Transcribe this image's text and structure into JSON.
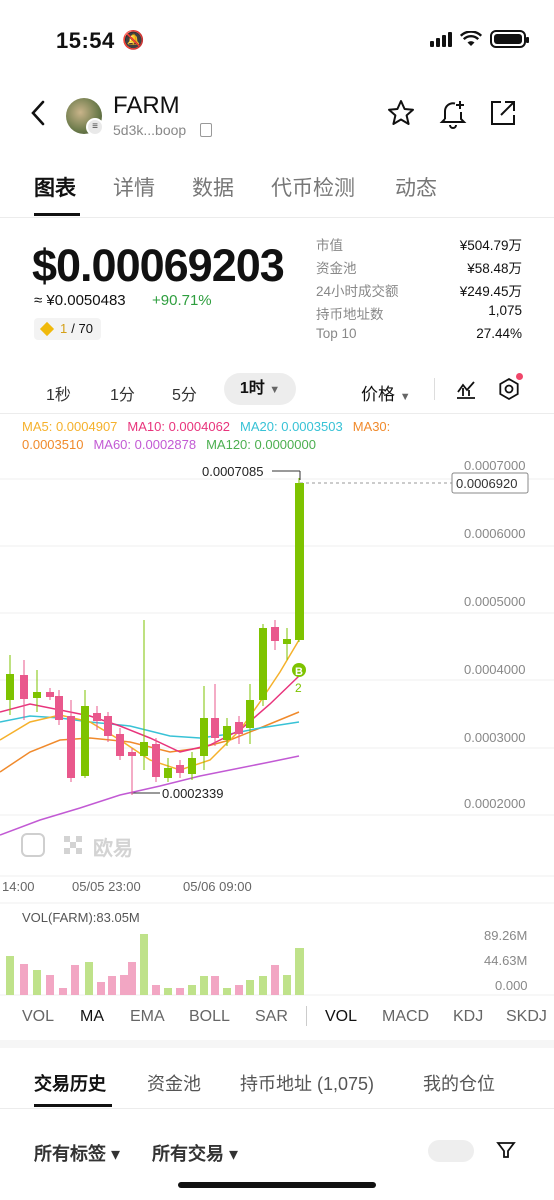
{
  "status_bar": {
    "time": "15:54"
  },
  "header": {
    "token_name": "FARM",
    "token_address": "5d3k...boop"
  },
  "tabs": [
    "图表",
    "详情",
    "数据",
    "代币检测",
    "动态"
  ],
  "price": {
    "usd": "$0.00069203",
    "cny": "≈ ¥0.0050483",
    "change": "+90.71%",
    "rank_current": "1",
    "rank_total": "/ 70"
  },
  "stats": [
    {
      "label": "市值",
      "value": "¥504.79万"
    },
    {
      "label": "资金池",
      "value": "¥58.48万"
    },
    {
      "label": "24小时成交额",
      "value": "¥249.45万"
    },
    {
      "label": "持币地址数",
      "value": "1,075"
    },
    {
      "label": "Top 10",
      "value": "27.44%"
    }
  ],
  "intervals": [
    "1秒",
    "1分",
    "5分",
    "1时"
  ],
  "active_interval": "1时",
  "price_selector": "价格",
  "ma_legend": {
    "ma5": "MA5: 0.0004907",
    "ma10": "MA10: 0.0004062",
    "ma20": "MA20: 0.0003503",
    "ma30": "MA30:",
    "ma30_val": "0.0003510",
    "ma60": "MA60: 0.0002878",
    "ma120": "MA120: 0.0000000"
  },
  "chart_data": {
    "type": "candlestick",
    "y_ticks": [
      "0.0007000",
      "0.0006000",
      "0.0005000",
      "0.0004000",
      "0.0003000",
      "0.0002000"
    ],
    "current_price_label": "0.0006920",
    "high_label": "0.0007085",
    "low_label": "0.0002339",
    "x_labels": [
      "14:00",
      "05/05 23:00",
      "05/06 09:00"
    ],
    "marker": "B",
    "marker_count": "2",
    "watermark": "欧易",
    "colors": {
      "up": "#7ec300",
      "down": "#e9588c",
      "ma5": "#f5b12c",
      "ma10": "#e8347c",
      "ma20": "#38c2d6",
      "ma30": "#f08a2c",
      "ma60": "#c25ad4",
      "ma120": "#4caf50"
    }
  },
  "volume": {
    "label": "VOL(FARM):83.05M",
    "ticks": [
      "89.26M",
      "44.63M",
      "0.000"
    ]
  },
  "indicators": [
    "VOL",
    "MA",
    "EMA",
    "BOLL",
    "SAR",
    "VOL",
    "MACD",
    "KDJ",
    "SKDJ"
  ],
  "bottom_tabs": [
    "交易历史",
    "资金池",
    "持币地址 (1,075)",
    "我的仓位"
  ],
  "filters": [
    "所有标签 ▾",
    "所有交易 ▾"
  ]
}
